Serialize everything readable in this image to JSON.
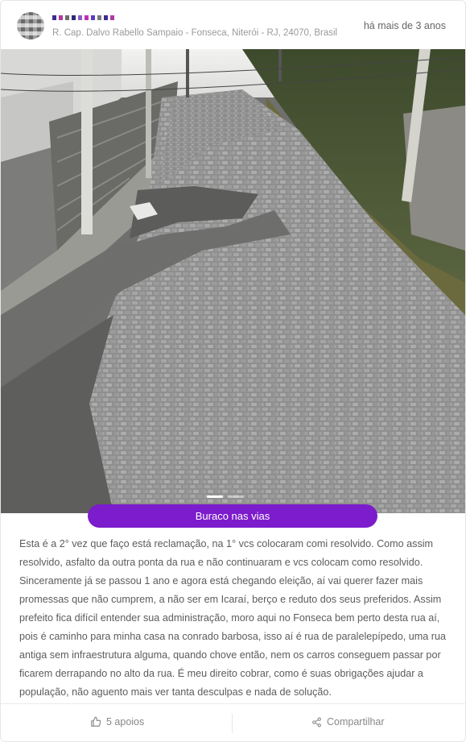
{
  "post": {
    "author_name": "",
    "address": "R. Cap. Dalvo Rabello Sampaio - Fonseca, Niterói - RJ, 24070, Brasil",
    "time": "há mais de 3 anos",
    "category": "Buraco nas vias",
    "text": "Esta é a 2° vez que faço está reclamação, na 1° vcs colocaram comi resolvido. Como assim resolvido, asfalto da outra ponta da rua e não continuaram e vcs colocam como resolvido. Sinceramente já se passou 1 ano e agora está chegando eleição, aí vai querer fazer mais promessas que não cumprem, a não ser em Icaraí, berço e reduto dos seus preferidos. Assim prefeito fica difícil entender sua administração, moro aqui no Fonseca bem perto desta rua aí, pois é caminho para minha casa na conrado barbosa, isso aí é rua de paralelepípedo, uma rua antiga sem infraestrutura alguma, quando chove então, nem os carros conseguem passar por ficarem derrapando no alto da rua. É meu direito cobrar, como é suas obrigações ajudar a população, não aguento mais ver tanta desculpas e nada de solução.",
    "carousel": {
      "count": 2,
      "active": 1
    }
  },
  "actions": {
    "support_label": "5 apoios",
    "share_label": "Compartilhar"
  },
  "colors": {
    "category_bg": "#7c1ccc",
    "muted_text": "#9a9a9a",
    "border": "#e6e6e6"
  },
  "icons": {
    "support": "thumbs-up-icon",
    "share": "share-icon"
  }
}
